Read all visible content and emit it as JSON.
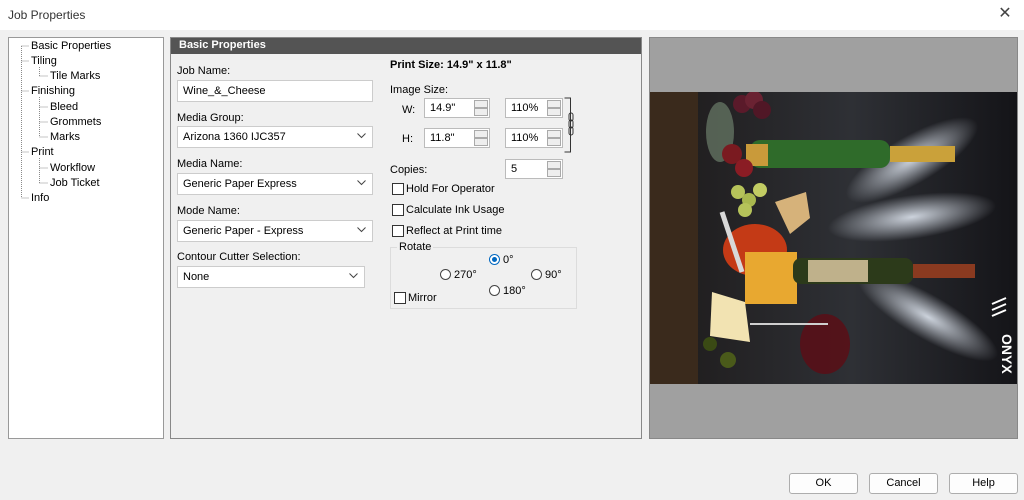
{
  "window": {
    "title": "Job Properties",
    "close_glyph": "✕"
  },
  "tree": {
    "items": [
      {
        "label": "Basic Properties"
      },
      {
        "label": "Tiling"
      },
      {
        "label": "Tile Marks"
      },
      {
        "label": "Finishing"
      },
      {
        "label": "Bleed"
      },
      {
        "label": "Grommets"
      },
      {
        "label": "Marks"
      },
      {
        "label": "Print"
      },
      {
        "label": "Workflow"
      },
      {
        "label": "Job Ticket"
      },
      {
        "label": "Info"
      }
    ]
  },
  "panel": {
    "header": "Basic Properties",
    "job_name": {
      "label": "Job Name:",
      "value": "Wine_&_Cheese"
    },
    "media_group": {
      "label": "Media Group:",
      "value": "Arizona 1360 IJC357"
    },
    "media_name": {
      "label": "Media Name:",
      "value": "Generic Paper Express"
    },
    "mode_name": {
      "label": "Mode Name:",
      "value": "Generic Paper - Express"
    },
    "contour": {
      "label": "Contour Cutter Selection:",
      "value": "None"
    },
    "print_size": "Print Size: 14.9\" x 11.8\"",
    "image_size": {
      "label": "Image Size:",
      "w_label": "W:",
      "w_value": "14.9\"",
      "w_pct": "110%",
      "h_label": "H:",
      "h_value": "11.8\"",
      "h_pct": "110%"
    },
    "copies": {
      "label": "Copies:",
      "value": "5"
    },
    "hold_for_operator": {
      "label": "Hold For Operator",
      "checked": false
    },
    "calculate_ink": {
      "label": "Calculate Ink Usage",
      "checked": false
    },
    "reflect_print": {
      "label": "Reflect at Print time",
      "checked": false
    },
    "rotate": {
      "label": "Rotate",
      "options": [
        "0°",
        "270°",
        "90°",
        "180°"
      ],
      "selected": "0°",
      "mirror": "Mirror"
    }
  },
  "preview": {
    "brand": "ONYX"
  },
  "buttons": {
    "ok": "OK",
    "cancel": "Cancel",
    "help": "Help"
  },
  "colors": {
    "header_bg": "#545454",
    "accent": "#0067c0"
  }
}
